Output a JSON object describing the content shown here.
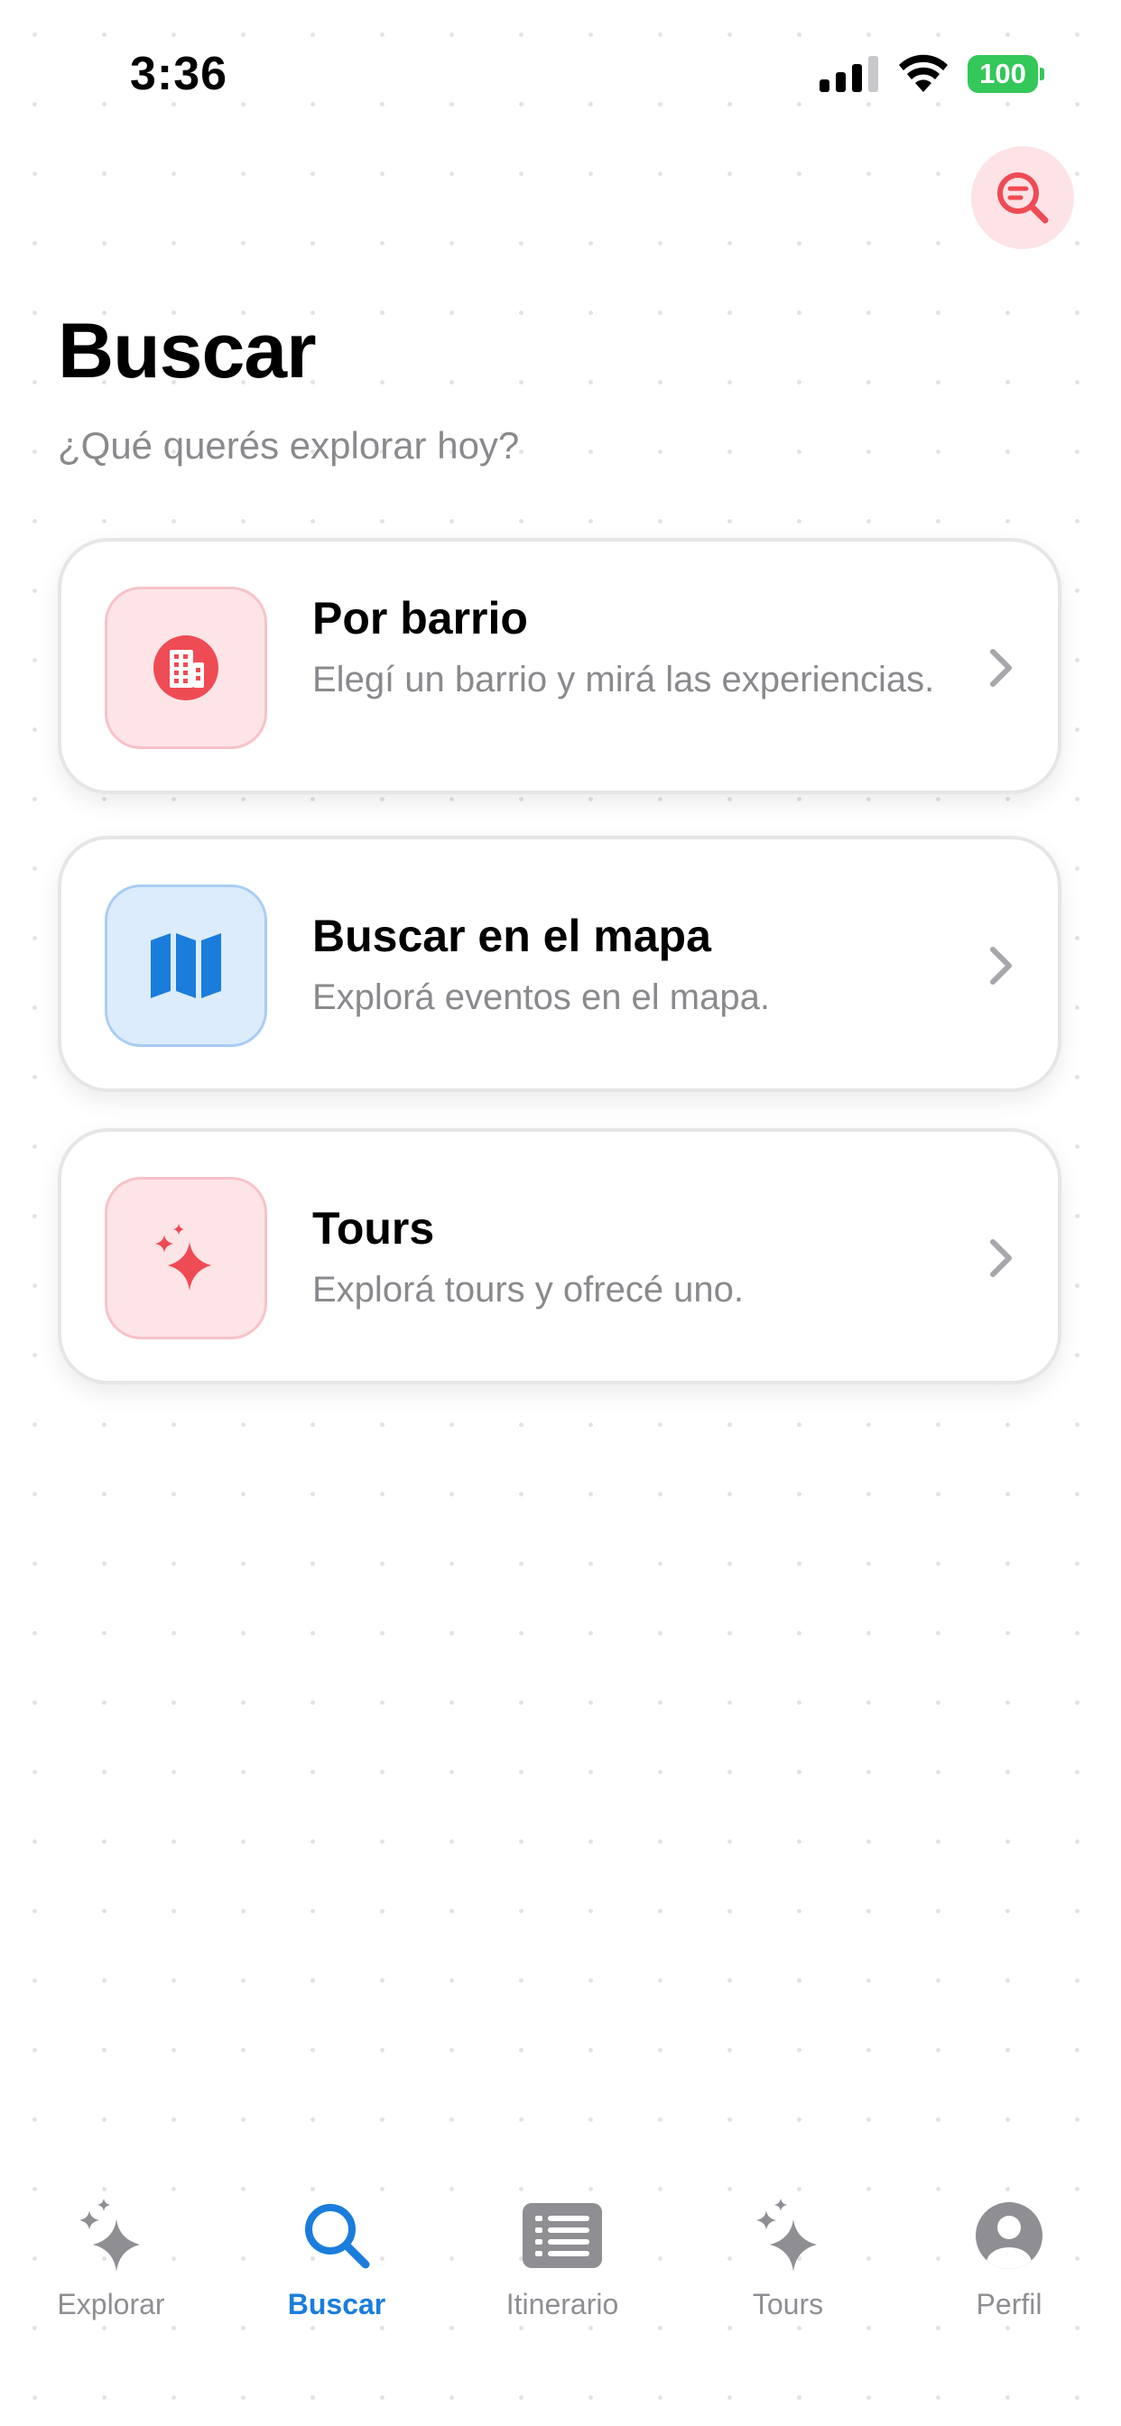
{
  "status_bar": {
    "time": "3:36",
    "battery": "100"
  },
  "header": {
    "title": "Buscar",
    "subtitle": "¿Qué querés explorar hoy?",
    "action_icon": "search-filter-icon"
  },
  "cards": [
    {
      "title": "Por barrio",
      "description": "Elegí un barrio y mirá las experiencias.",
      "icon": "building-icon",
      "accent": "#ef4b55"
    },
    {
      "title": "Buscar en el mapa",
      "description": "Explorá eventos en el mapa.",
      "icon": "map-icon",
      "accent": "#1a7ddc"
    },
    {
      "title": "Tours",
      "description": "Explorá tours y ofrecé uno.",
      "icon": "sparkles-icon",
      "accent": "#ef4b55"
    }
  ],
  "tab_bar": {
    "active": "Buscar",
    "items": [
      {
        "label": "Explorar",
        "icon": "sparkles-icon"
      },
      {
        "label": "Buscar",
        "icon": "search-icon"
      },
      {
        "label": "Itinerario",
        "icon": "list-icon"
      },
      {
        "label": "Tours",
        "icon": "sparkles-icon"
      },
      {
        "label": "Perfil",
        "icon": "person-circle-icon"
      }
    ]
  },
  "colors": {
    "active_tab": "#1a7ddc",
    "inactive": "#8e8e93",
    "battery": "#34c759",
    "accent_red": "#ef4b55"
  }
}
